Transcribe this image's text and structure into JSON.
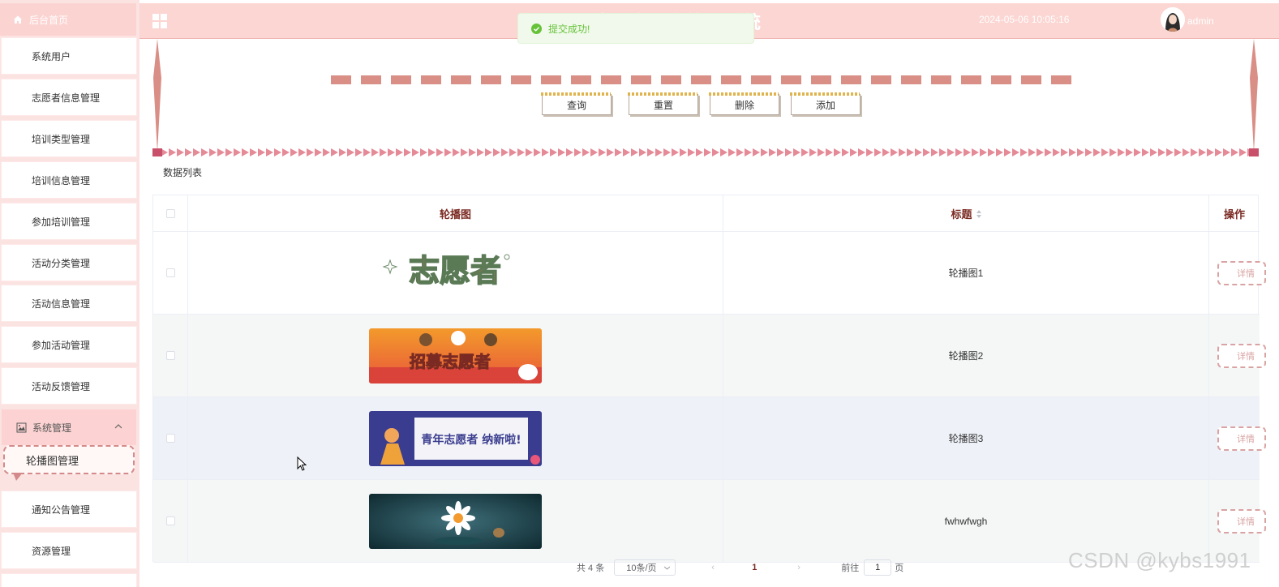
{
  "header": {
    "title": "志愿者服务管理系统",
    "datetime": "2024-05-06 10:05:16",
    "user": "admin"
  },
  "toast": {
    "message": "提交成功!"
  },
  "sidebar": {
    "home": "后台首页",
    "items": [
      "系统用户",
      "志愿者信息管理",
      "培训类型管理",
      "培训信息管理",
      "参加培训管理",
      "活动分类管理",
      "活动信息管理",
      "参加活动管理",
      "活动反馈管理"
    ],
    "group": "系统管理",
    "active_item": "轮播图管理",
    "items_after": [
      "通知公告管理",
      "资源管理"
    ]
  },
  "search": {
    "buttons": {
      "query": "查询",
      "reset": "重置",
      "delete": "删除",
      "add": "添加"
    }
  },
  "list_title": "数据列表",
  "table": {
    "columns": {
      "image": "轮播图",
      "title": "标题",
      "action": "操作"
    },
    "rows": [
      {
        "image": "志愿者",
        "title": "轮播图1",
        "action": "详情"
      },
      {
        "image": "招募志愿者",
        "title": "轮播图2",
        "action": "详情"
      },
      {
        "image": "青年志愿者 纳新啦!",
        "title": "轮播图3",
        "action": "详情"
      },
      {
        "image": "flower-photo",
        "title": "fwhwfwgh",
        "action": "详情"
      }
    ]
  },
  "pagination": {
    "total": "共 4 条",
    "page_size": "10条/页",
    "prev": "‹",
    "current": "1",
    "next": "›",
    "goto_label": "前往",
    "goto_value": "1",
    "goto_unit": "页"
  },
  "watermark": "CSDN @kybs1991"
}
